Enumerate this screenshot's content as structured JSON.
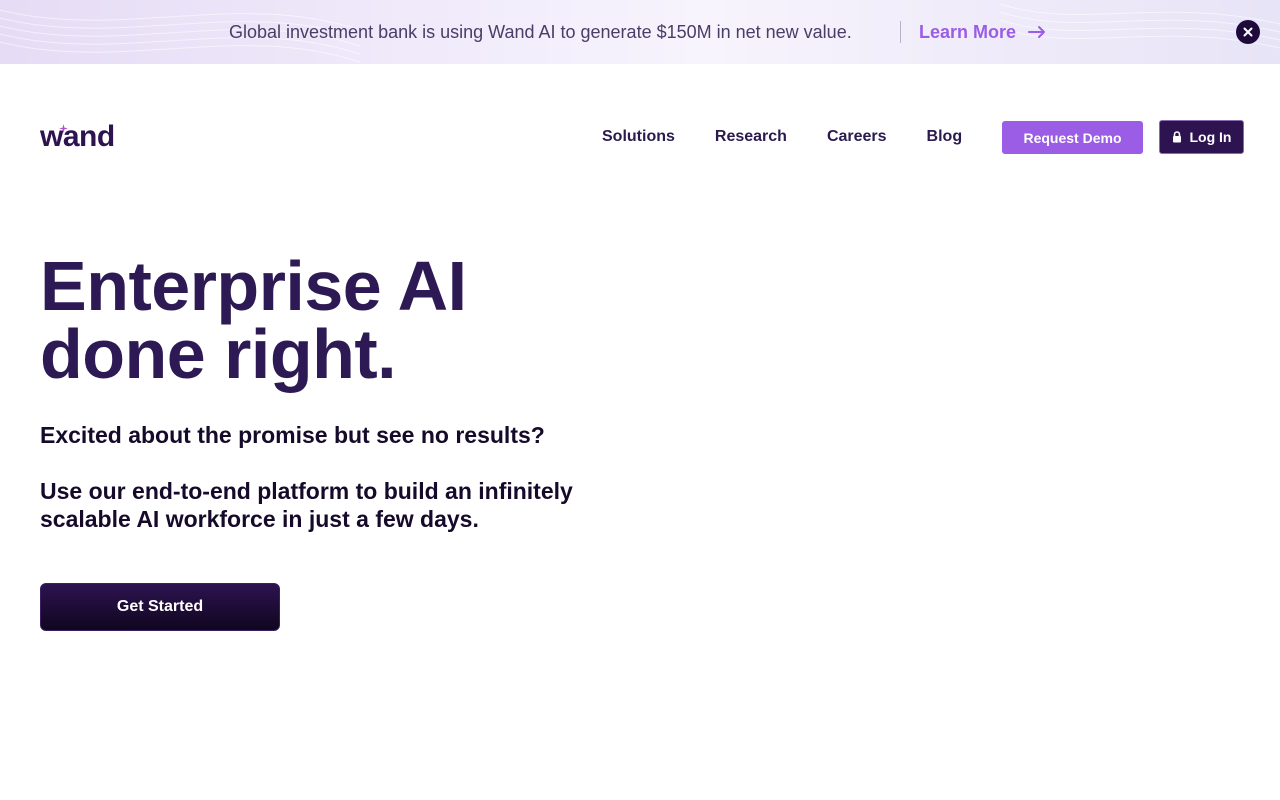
{
  "banner": {
    "message": "Global investment bank is using Wand AI to generate $150M in net new value.",
    "link_label": "Learn More",
    "arrow_icon": "arrow-right-icon",
    "close_icon": "close-icon"
  },
  "header": {
    "logo_text": "wand",
    "nav": [
      {
        "label": "Solutions"
      },
      {
        "label": "Research"
      },
      {
        "label": "Careers"
      },
      {
        "label": "Blog"
      }
    ],
    "request_demo_label": "Request Demo",
    "login_label": "Log In",
    "login_icon": "lock-icon"
  },
  "hero": {
    "title_line1": "Enterprise AI",
    "title_line2": "done right.",
    "subtitle": "Excited about the promise but see no results?",
    "body": "Use our end-to-end platform to build an infinitely scalable AI workforce in just a few days.",
    "cta_label": "Get Started"
  },
  "colors": {
    "brand_dark": "#2d1350",
    "accent_purple": "#9b5de5",
    "banner_bg": "#efe9fa"
  }
}
